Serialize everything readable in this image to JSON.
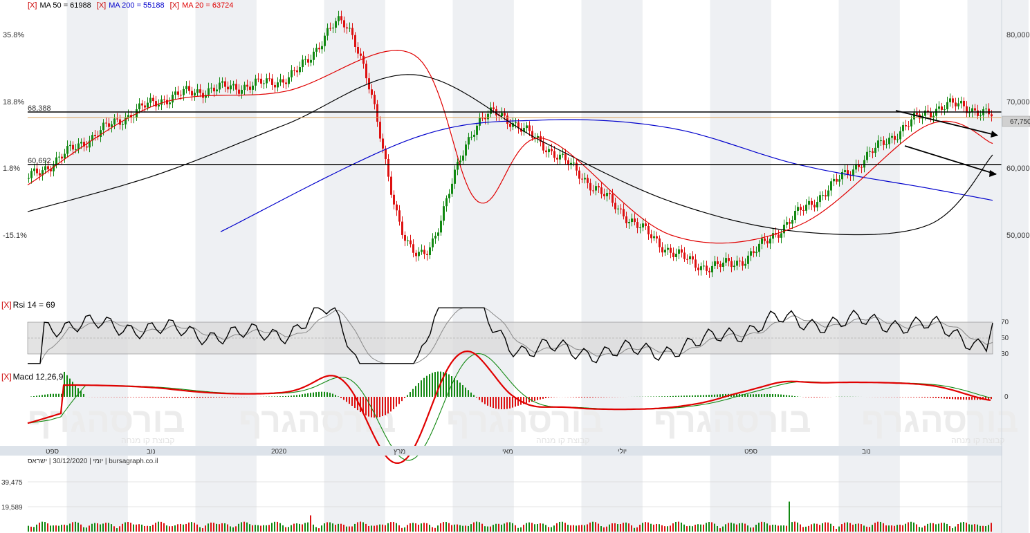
{
  "colors": {
    "ma50": "#000000",
    "ma200": "#0000cc",
    "ma20": "#e00000",
    "up": "#118811",
    "down": "#dd1111",
    "band": "#d9d9d9",
    "stripe": "#eef0f3",
    "axisbar": "#dde3ea",
    "hline": "#000000",
    "pricebar": "#d9a05a",
    "watermark": "#e8e8e8"
  },
  "legend": {
    "x_marker": "[X]",
    "ma50": "MA 50 = 61988",
    "ma200": "MA 200 = 55188",
    "ma20": "MA 20 = 63724"
  },
  "price_panel": {
    "left_percent_ticks": [
      "35.8%",
      "18.8%",
      "1.8%",
      "-15.1%"
    ],
    "right_price_ticks": [
      "80,000",
      "70,000",
      "60,000",
      "50,000"
    ],
    "last_price": "67,750",
    "level_labels": [
      "68,388",
      "60,692"
    ]
  },
  "rsi_panel": {
    "title": "Rsi 14 = 69",
    "ticks": [
      "70",
      "50",
      "30"
    ]
  },
  "macd_panel": {
    "title": "Macd 12,26,9",
    "zero_label": "0"
  },
  "watermark": {
    "text": "בורסהגרף",
    "subtext": "קבוצת קו מנחה"
  },
  "time_axis": [
    "ספט",
    "נוב",
    "2020",
    "מרץ",
    "מאי",
    "יולי",
    "ספט",
    "נוב"
  ],
  "volume_panel": {
    "info": "יומי | 30/12/2020 | ישראס | bursagraph.co.il",
    "ticks": [
      "39,475",
      "19,589"
    ]
  },
  "chart_data": {
    "type": "line",
    "title": "",
    "series": [
      {
        "name": "MA 50",
        "x": [
          "Sep 2019",
          "Nov 2019",
          "Jan 2020",
          "Mar 2020",
          "May 2020",
          "Jul 2020",
          "Sep 2020",
          "Nov 2020",
          "Dec 2020"
        ],
        "values": [
          53500,
          59000,
          66500,
          74000,
          64000,
          55000,
          50500,
          51500,
          62000
        ]
      },
      {
        "name": "MA 200",
        "x": [
          "Dec 2019",
          "Mar 2020",
          "May 2020",
          "Jul 2020",
          "Sep 2020",
          "Nov 2020",
          "Dec 2020"
        ],
        "values": [
          50500,
          64500,
          67200,
          66000,
          60500,
          57000,
          55200
        ]
      },
      {
        "name": "MA 20",
        "x": [
          "Sep 2019",
          "Nov 2019",
          "Jan 2020",
          "Mar 2020",
          "Apr 2020",
          "May 2020",
          "Jul 2020",
          "Sep 2020",
          "Nov 2020",
          "Dec 2020"
        ],
        "values": [
          57500,
          69500,
          71500,
          77000,
          55000,
          64500,
          50000,
          51500,
          66500,
          63700
        ]
      },
      {
        "name": "Close",
        "x": [
          "Sep 2019",
          "Nov 2019",
          "Jan 2020",
          "Feb 2020",
          "Mar 2020",
          "Apr 2020",
          "May 2020",
          "Jul 2020",
          "Aug 2020",
          "Sep 2020",
          "Nov 2020",
          "Dec 2020"
        ],
        "values": [
          58500,
          70000,
          73500,
          80500,
          47000,
          67000,
          63500,
          47500,
          46000,
          53500,
          68500,
          67750
        ]
      }
    ],
    "levels": [
      68388,
      60692
    ],
    "rsi": {
      "value": 69,
      "bands": [
        30,
        50,
        70
      ]
    },
    "volume_ticks": [
      19589,
      39475
    ],
    "ylim": [
      42000,
      84000
    ]
  }
}
